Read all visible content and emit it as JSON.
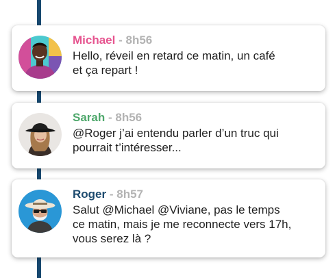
{
  "timeline": {
    "line_color": "#17486f",
    "messages": [
      {
        "author": "Michael",
        "author_color": "#e6548f",
        "separator": "-",
        "time": "8h56",
        "text": "Hello, réveil en retard ce matin, un café\net ça repart !",
        "avatar_icon": "avatar-michael-icon"
      },
      {
        "author": "Sarah",
        "author_color": "#4fa86c",
        "separator": "-",
        "time": "8h56",
        "text": "@Roger j’ai entendu parler d’un truc qui\npourrait t’intéresser...",
        "avatar_icon": "avatar-sarah-icon"
      },
      {
        "author": "Roger",
        "author_color": "#1c4a6e",
        "separator": "-",
        "time": "8h57",
        "text": "Salut @Michael @Viviane, pas le temps\nce matin, mais je me reconnecte vers 17h,\nvous serez là ?",
        "avatar_icon": "avatar-roger-icon"
      }
    ]
  }
}
